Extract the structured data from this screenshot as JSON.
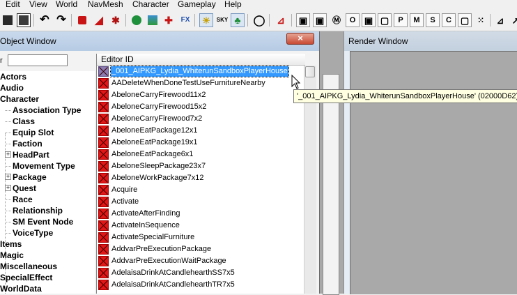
{
  "menu": [
    "Edit",
    "View",
    "World",
    "NavMesh",
    "Character",
    "Gameplay",
    "Help"
  ],
  "toolbar": {
    "sky_label": "SKY",
    "box_labels": [
      "O",
      "P",
      "M",
      "S",
      "C"
    ]
  },
  "object_window": {
    "title": "Object Window",
    "close_symbol": "×",
    "filter_label": "r",
    "filter_value": "",
    "tree": [
      {
        "label": "Actors",
        "level": 0
      },
      {
        "label": "Audio",
        "level": 0
      },
      {
        "label": "Character",
        "level": 0
      },
      {
        "label": "Association Type",
        "level": 1
      },
      {
        "label": "Class",
        "level": 1
      },
      {
        "label": "Equip Slot",
        "level": 1
      },
      {
        "label": "Faction",
        "level": 1
      },
      {
        "label": "HeadPart",
        "level": 1,
        "expander": "+"
      },
      {
        "label": "Movement Type",
        "level": 1
      },
      {
        "label": "Package",
        "level": 1,
        "expander": "+"
      },
      {
        "label": "Quest",
        "level": 1,
        "expander": "+"
      },
      {
        "label": "Race",
        "level": 1
      },
      {
        "label": "Relationship",
        "level": 1
      },
      {
        "label": "SM Event Node",
        "level": 1
      },
      {
        "label": "VoiceType",
        "level": 1
      },
      {
        "label": "Items",
        "level": 0
      },
      {
        "label": "Magic",
        "level": 0
      },
      {
        "label": "Miscellaneous",
        "level": 0
      },
      {
        "label": "SpecialEffect",
        "level": 0
      },
      {
        "label": "WorldData",
        "level": 0
      }
    ],
    "list_header": "Editor ID",
    "list_items": [
      "_001_AIPKG_Lydia_WhiterunSandboxPlayerHouse",
      "AADeleteWhenDoneTestUseFurnitureNearby",
      "AbeloneCarryFirewood11x2",
      "AbeloneCarryFirewood15x2",
      "AbeloneCarryFirewood7x2",
      "AbeloneEatPackage12x1",
      "AbeloneEatPackage19x1",
      "AbeloneEatPackage6x1",
      "AbeloneSleepPackage23x7",
      "AbeloneWorkPackage7x12",
      "Acquire",
      "Activate",
      "ActivateAfterFinding",
      "ActivateInSequence",
      "ActivateSpecialFurniture",
      "AddvarPreExecutionPackage",
      "AddvarPreExecutionWaitPackage",
      "AdelaisaDrinkAtCandlehearthSS7x5",
      "AdelaisaDrinkAtCandlehearthTR7x5"
    ],
    "selected_index": 0,
    "tooltip": "'_001_AIPKG_Lydia_WhiterunSandboxPlayerHouse' (02000D62)"
  },
  "render_window": {
    "title": "Render Window"
  }
}
